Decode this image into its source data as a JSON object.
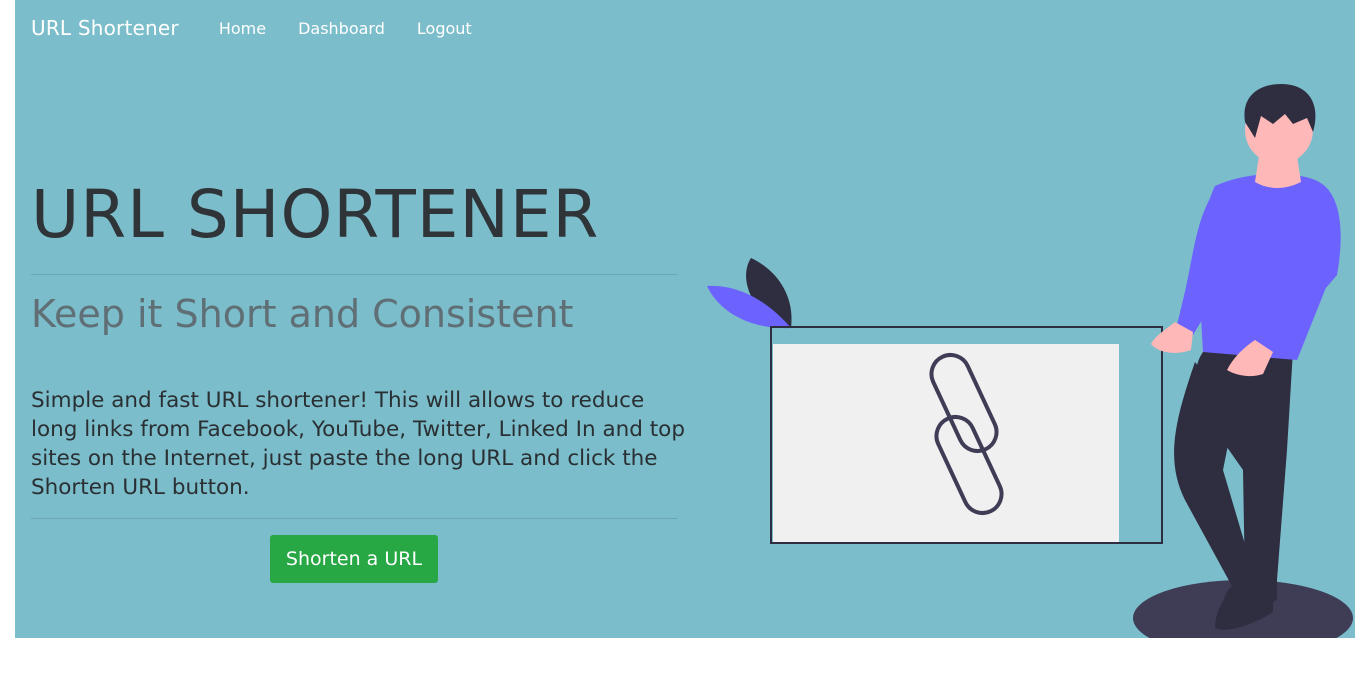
{
  "navbar": {
    "brand": "URL Shortener",
    "links": [
      "Home",
      "Dashboard",
      "Logout"
    ]
  },
  "hero": {
    "title": "URL SHORTENER",
    "subtitle": "Keep it Short and Consistent",
    "description": "Simple and fast URL shortener! This will allows to reduce long links from Facebook, YouTube, Twitter, Linked In and top sites on the Internet, just paste the long URL and click the Shorten URL button.",
    "cta_label": "Shorten a URL"
  },
  "colors": {
    "hero_background": "#7bbdca",
    "cta_background": "#28a745",
    "accent_purple": "#6c63ff",
    "dark_navy": "#2f2e41"
  },
  "icons": [
    "chain-link-icon",
    "leaf-icon",
    "person-illustration"
  ]
}
